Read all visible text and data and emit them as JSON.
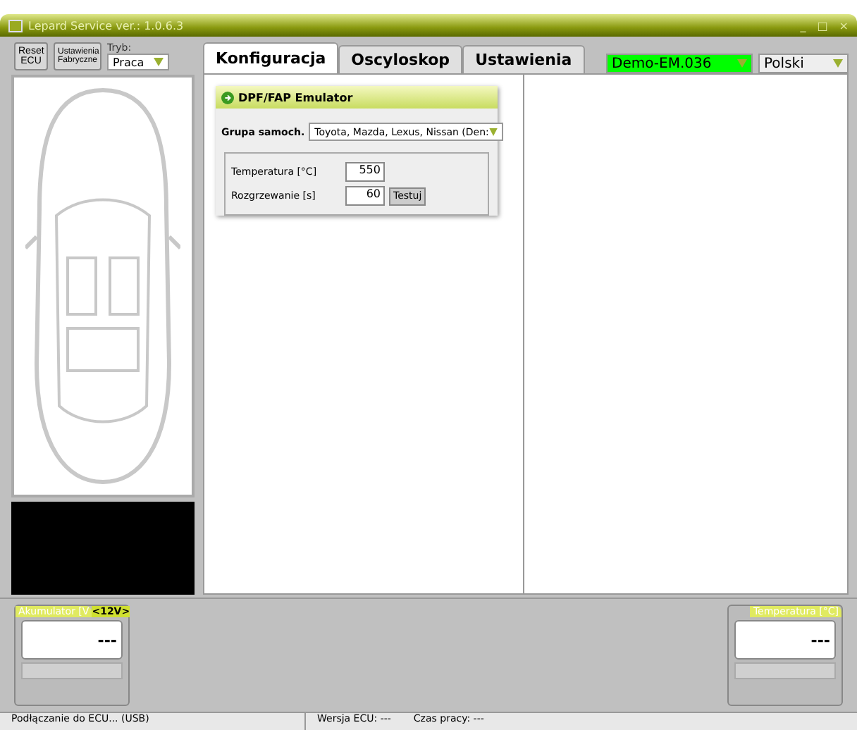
{
  "window": {
    "title": "Lepard Service  ver.: 1.0.6.3",
    "controls": [
      "_",
      "□",
      "×"
    ]
  },
  "toolbar": {
    "buttons": [
      "Reset ECU",
      "Ustawienia Fabryczne"
    ],
    "mode": {
      "label": "Tryb:",
      "value": "Praca"
    }
  },
  "tabs": [
    {
      "label": "Konfiguracja",
      "selected": true
    },
    {
      "label": "Oscyloskop",
      "selected": false
    },
    {
      "label": "Ustawienia",
      "selected": false
    }
  ],
  "device_select": {
    "value": "Demo-EM.036",
    "color": "#00ff00"
  },
  "language_select": {
    "value": "Polski"
  },
  "emulator_panel": {
    "title": "DPF/FAP Emulator",
    "group": {
      "label": "Grupa samoch.",
      "value": "Toyota, Mazda, Lexus, Nissan (Den:"
    },
    "fields": [
      {
        "label": "Temperatura [°C]",
        "value": "550"
      },
      {
        "label": "Rozgrzewanie [s]",
        "value": "60",
        "button": "Testuj"
      }
    ]
  },
  "gauges": [
    {
      "title": "Akumulator [V",
      "badge": "<12V>",
      "value": "---"
    },
    {
      "title": "Temperatura [°C]",
      "value": "---"
    }
  ],
  "status_bar": [
    "Podłączanie do ECU... (USB)",
    "Wersja ECU: ---",
    "Czas pracy: ---"
  ]
}
